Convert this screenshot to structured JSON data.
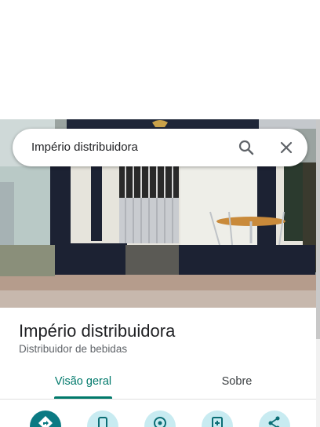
{
  "search": {
    "query": "Império distribuidora",
    "search_icon": "search-icon",
    "clear_icon": "close-icon"
  },
  "place": {
    "name": "Império distribuidora",
    "category": "Distribuidor de bebidas"
  },
  "tabs": [
    {
      "label": "Visão geral",
      "selected": true
    },
    {
      "label": "Sobre",
      "selected": false
    }
  ],
  "actions": [
    {
      "icon": "directions-icon"
    },
    {
      "icon": "phone-icon"
    },
    {
      "icon": "location-save-icon"
    },
    {
      "icon": "add-photo-icon"
    },
    {
      "icon": "share-icon"
    }
  ],
  "colors": {
    "accent": "#00796b",
    "primary_action": "#0b7a83",
    "secondary_action": "#c8ebf1"
  }
}
